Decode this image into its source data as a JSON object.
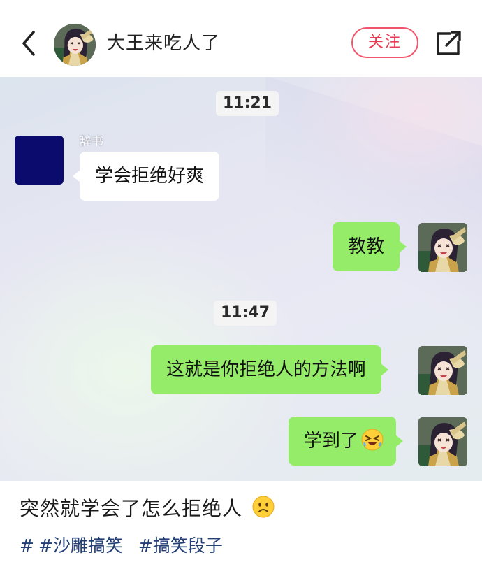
{
  "header": {
    "username": "大王来吃人了",
    "follow_label": "关注",
    "back_icon": "chevron-left-icon",
    "share_icon": "share-icon"
  },
  "chat": {
    "timestamps": [
      "11:21",
      "11:47"
    ],
    "messages": [
      {
        "side": "left",
        "sender": "辞书",
        "text": "学会拒绝好爽"
      },
      {
        "side": "right",
        "text": "教教"
      },
      {
        "side": "right",
        "text": "这就是你拒绝人的方法啊"
      },
      {
        "side": "right",
        "text": "学到了",
        "emoji": "laughing-squint-emoji"
      }
    ]
  },
  "post": {
    "caption": "突然就学会了怎么拒绝人",
    "caption_emoji": "frowning-face-emoji",
    "tag_hash": "#",
    "tags": [
      "#沙雕搞笑",
      "#搞笑段子"
    ]
  },
  "colors": {
    "accent": "#e83b53",
    "bubble_green": "#95ec69",
    "bubble_white": "#ffffff",
    "tag_blue": "#233f75",
    "avatar_navy": "#0b0b6e"
  }
}
